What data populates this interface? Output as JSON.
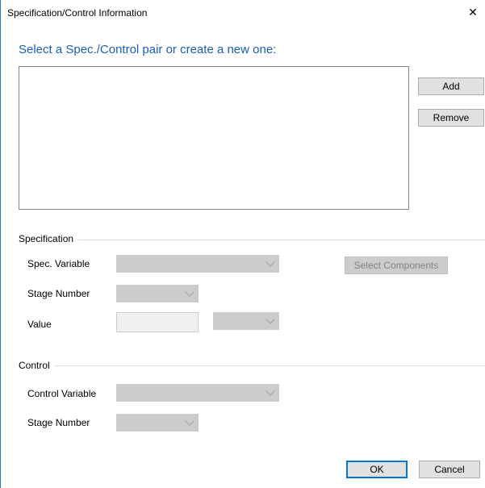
{
  "window": {
    "title": "Specification/Control Information",
    "close_glyph": "✕"
  },
  "instruction": "Select a Spec./Control pair or create a new one:",
  "pair_list": {
    "items": []
  },
  "side_buttons": {
    "add_label": "Add",
    "remove_label": "Remove"
  },
  "specification": {
    "group_label": "Specification",
    "spec_variable_label": "Spec. Variable",
    "stage_number_label": "Stage Number",
    "value_label": "Value",
    "select_components_label": "Select Components",
    "spec_variable_value": "",
    "stage_number_value": "",
    "value_value": "",
    "value_unit_value": ""
  },
  "control": {
    "group_label": "Control",
    "control_variable_label": "Control Variable",
    "stage_number_label": "Stage Number",
    "control_variable_value": "",
    "stage_number_value": ""
  },
  "footer": {
    "ok_label": "OK",
    "cancel_label": "Cancel"
  },
  "colors": {
    "instruction_text": "#1a5fb4",
    "window_border": "#1979ca",
    "disabled_field": "#cccccc",
    "primary_button_border": "#0078d7"
  }
}
